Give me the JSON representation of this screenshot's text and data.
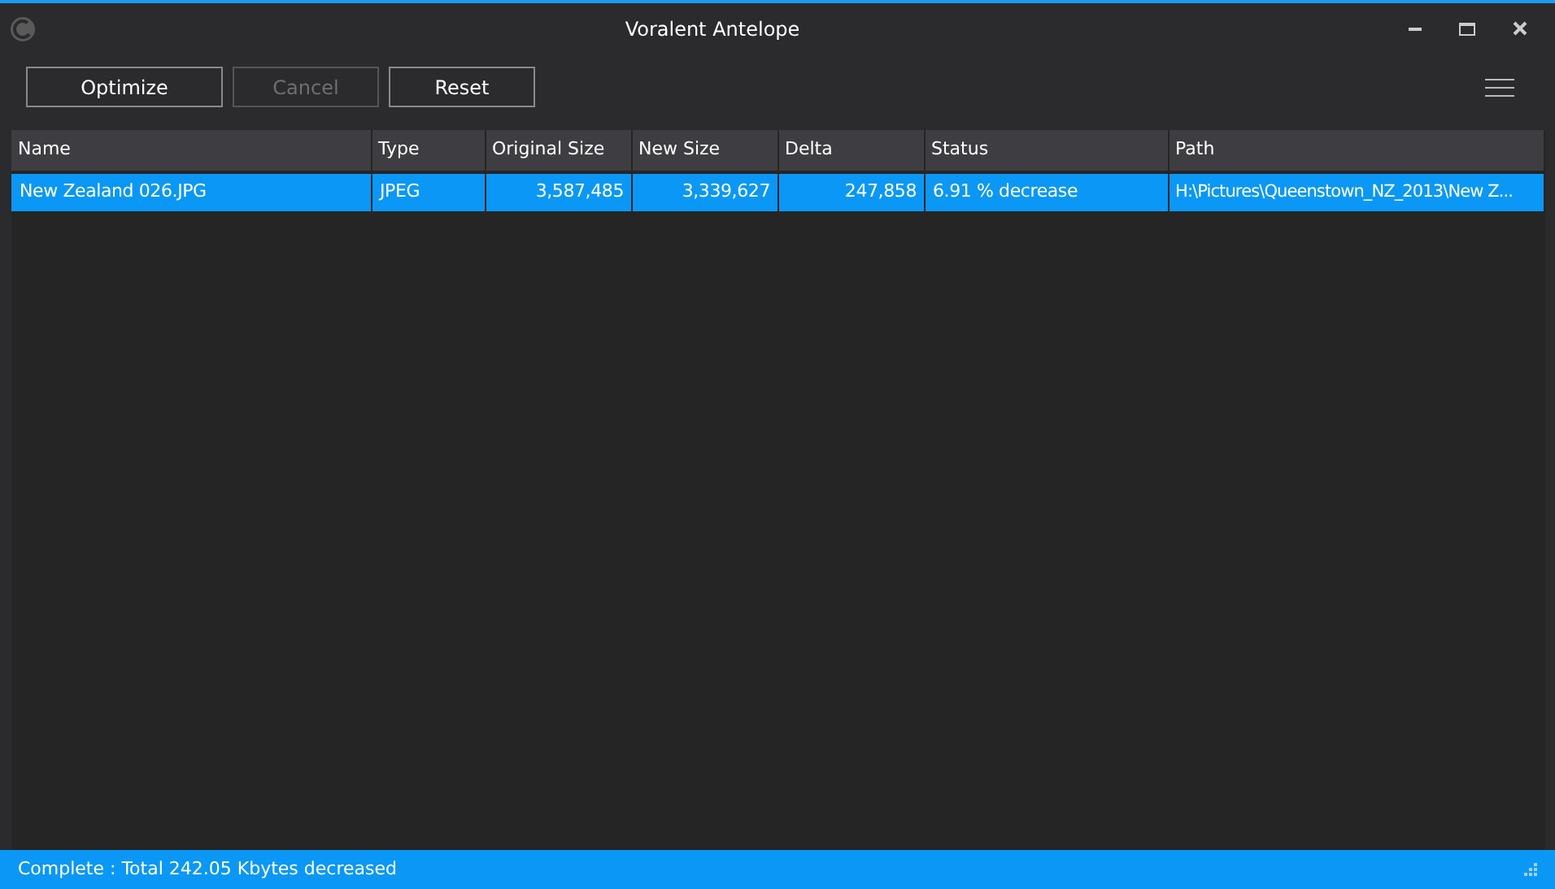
{
  "window": {
    "title": "Voralent Antelope"
  },
  "toolbar": {
    "buttons": [
      {
        "label": "Optimize",
        "disabled": false
      },
      {
        "label": "Cancel",
        "disabled": true
      },
      {
        "label": "Reset",
        "disabled": false
      }
    ]
  },
  "table": {
    "columns": [
      {
        "label": "Name",
        "kind": "text"
      },
      {
        "label": "Type",
        "kind": "text"
      },
      {
        "label": "Original Size",
        "kind": "number"
      },
      {
        "label": "New Size",
        "kind": "number"
      },
      {
        "label": "Delta",
        "kind": "number"
      },
      {
        "label": "Status",
        "kind": "text"
      },
      {
        "label": "Path",
        "kind": "text"
      }
    ],
    "rows": [
      {
        "selected": true,
        "cells": [
          "New Zealand 026.JPG",
          "JPEG",
          "3,587,485",
          "3,339,627",
          "247,858",
          "6.91 % decrease",
          "H:\\Pictures\\Queenstown_NZ_2013\\New Z..."
        ]
      }
    ]
  },
  "status_bar": {
    "text": "Complete : Total 242.05 Kbytes decreased"
  }
}
